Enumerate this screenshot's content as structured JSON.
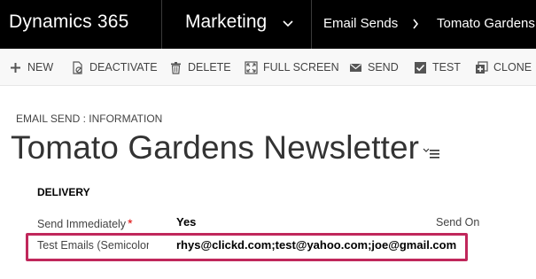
{
  "topbar": {
    "app_title": "Dynamics 365",
    "area": "Marketing",
    "breadcrumb_entity": "Email Sends",
    "breadcrumb_record": "Tomato Gardens"
  },
  "commands": {
    "new": "NEW",
    "deactivate": "DEACTIVATE",
    "delete": "DELETE",
    "full_screen": "FULL SCREEN",
    "send": "SEND",
    "test": "TEST",
    "clone": "CLONE"
  },
  "form": {
    "label": "EMAIL SEND : INFORMATION",
    "record_title": "Tomato Gardens Newsletter"
  },
  "delivery": {
    "section_title": "DELIVERY",
    "send_immediately_label": "Send Immediately",
    "required_mark": "*",
    "send_immediately_value": "Yes",
    "send_on_label": "Send On",
    "test_emails_label": "Test Emails (Semicolon",
    "test_emails_value": "rhys@clickd.com;test@yahoo.com;joe@gmail.com"
  },
  "colors": {
    "topbar_bg": "#000000",
    "highlight_border": "#c0275b",
    "required": "#dd0000"
  }
}
